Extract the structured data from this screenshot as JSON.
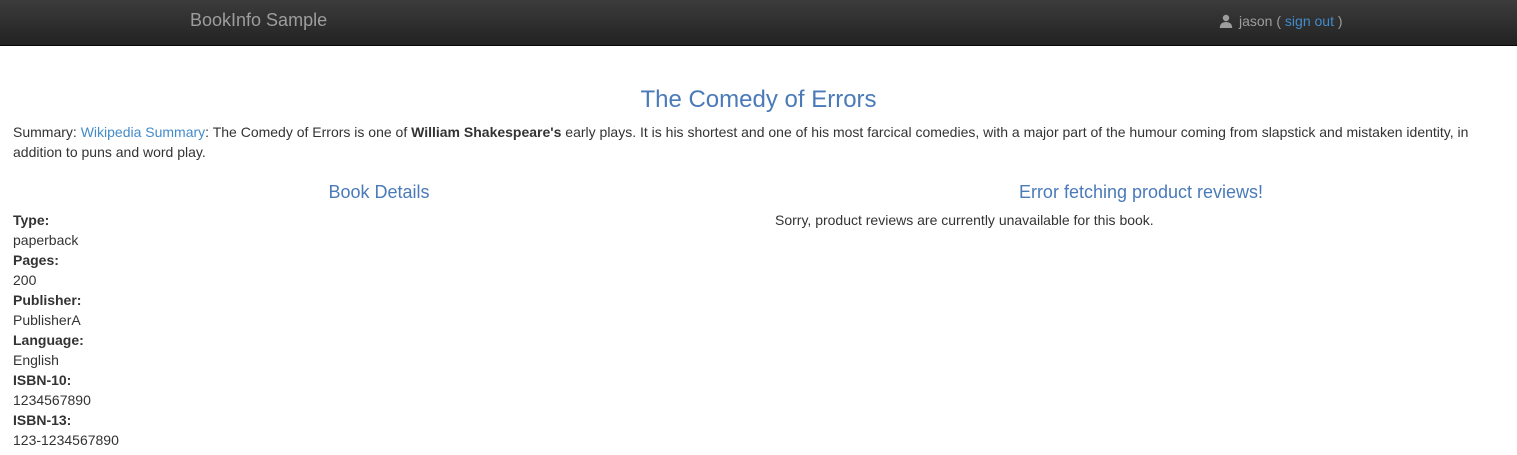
{
  "navbar": {
    "brand": "BookInfo Sample",
    "user": {
      "icon": "user-icon",
      "name": "jason (",
      "signout_label": "sign out",
      "close_paren": ")"
    }
  },
  "book": {
    "title": "The Comedy of Errors",
    "summary": {
      "prefix": "Summary: ",
      "link_label": "Wikipedia Summary",
      "text_1": ": The Comedy of Errors is one of ",
      "author": "William Shakespeare's",
      "text_2": " early plays. It is his shortest and one of his most farcical comedies, with a major part of the humour coming from slapstick and mistaken identity, in addition to puns and word play."
    }
  },
  "details": {
    "heading": "Book Details",
    "items": [
      {
        "label": "Type:",
        "value": "paperback"
      },
      {
        "label": "Pages:",
        "value": "200"
      },
      {
        "label": "Publisher:",
        "value": "PublisherA"
      },
      {
        "label": "Language:",
        "value": "English"
      },
      {
        "label": "ISBN-10:",
        "value": "1234567890"
      },
      {
        "label": "ISBN-13:",
        "value": "123-1234567890"
      }
    ]
  },
  "reviews": {
    "heading": "Error fetching product reviews!",
    "message": "Sorry, product reviews are currently unavailable for this book."
  },
  "colors": {
    "navbar": "#222222",
    "brand_text": "#9d9d9d",
    "heading": "#4a7ab8",
    "link": "#428bca",
    "body_text": "#333333"
  }
}
